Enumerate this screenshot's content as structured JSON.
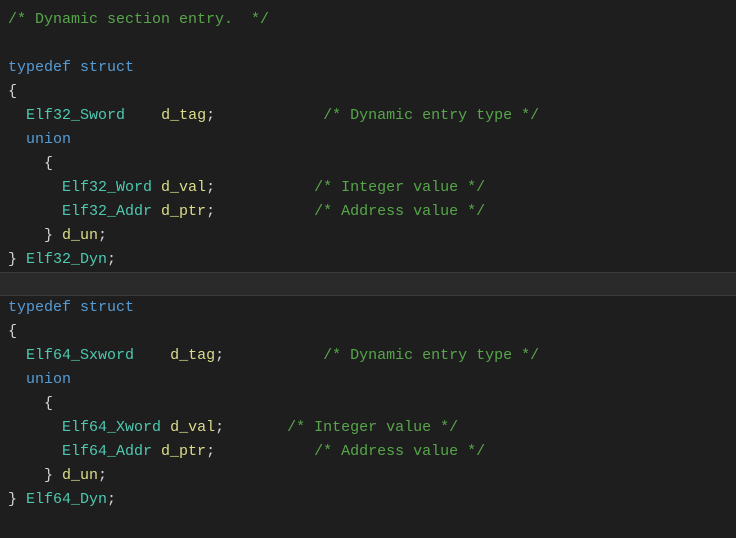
{
  "l1": "/* Dynamic section entry.  */",
  "l2": "",
  "l3_kw1": "typedef",
  "l3_kw2": " struct",
  "l4": "{",
  "l5_pad": "  ",
  "l5_type": "Elf32_Sword",
  "l5_sp": "    ",
  "l5_id": "d_tag",
  "l5_semi": ";            ",
  "l5_cm": "/* Dynamic entry type */",
  "l6_pad": "  ",
  "l6_kw": "union",
  "l7": "    {",
  "l8_pad": "      ",
  "l8_type": "Elf32_Word",
  "l8_sp": " ",
  "l8_id": "d_val",
  "l8_semi": ";           ",
  "l8_cm": "/* Integer value */",
  "l9_pad": "      ",
  "l9_type": "Elf32_Addr",
  "l9_sp": " ",
  "l9_id": "d_ptr",
  "l9_semi": ";           ",
  "l9_cm": "/* Address value */",
  "l10_pad": "    } ",
  "l10_id": "d_un",
  "l10_semi": ";",
  "l11_pad": "} ",
  "l11_type": "Elf32_Dyn",
  "l11_semi": ";",
  "l12": "",
  "l13_kw1": "typedef",
  "l13_kw2": " struct",
  "l14": "{",
  "l15_pad": "  ",
  "l15_type": "Elf64_Sxword",
  "l15_sp": "    ",
  "l15_id": "d_tag",
  "l15_semi": ";           ",
  "l15_cm": "/* Dynamic entry type */",
  "l16_pad": "  ",
  "l16_kw": "union",
  "l17": "    {",
  "l18_pad": "      ",
  "l18_type": "Elf64_Xword",
  "l18_sp": " ",
  "l18_id": "d_val",
  "l18_semi": ";       ",
  "l18_cm": "/* Integer value */",
  "l19_pad": "      ",
  "l19_type": "Elf64_Addr",
  "l19_sp": " ",
  "l19_id": "d_ptr",
  "l19_semi": ";           ",
  "l19_cm": "/* Address value */",
  "l20_pad": "    } ",
  "l20_id": "d_un",
  "l20_semi": ";",
  "l21_pad": "} ",
  "l21_type": "Elf64_Dyn",
  "l21_semi": ";"
}
